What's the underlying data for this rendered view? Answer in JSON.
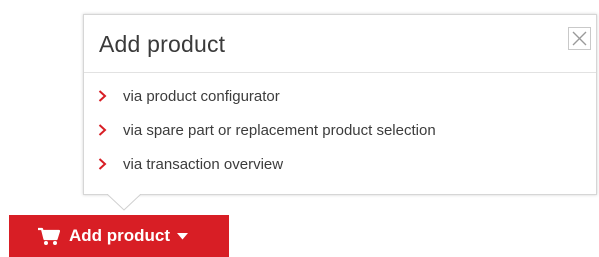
{
  "popover": {
    "title": "Add product",
    "close_icon": "close-icon",
    "options": [
      {
        "label": "via product configurator",
        "icon": "chevron-right-icon"
      },
      {
        "label": "via spare part or replacement product selection",
        "icon": "chevron-right-icon"
      },
      {
        "label": "via transaction overview",
        "icon": "chevron-right-icon"
      }
    ]
  },
  "add_button": {
    "label": "Add product",
    "icon": "cart-icon",
    "dropdown_icon": "caret-down-icon"
  },
  "colors": {
    "accent": "#d81e25",
    "chevron": "#d81e25",
    "text": "#3c3c3c"
  }
}
